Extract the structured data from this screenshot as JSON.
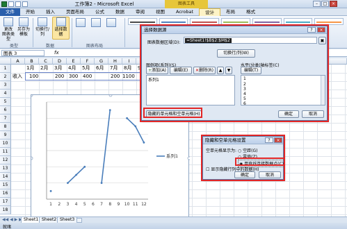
{
  "window": {
    "title": "工作簿2 - Microsoft Excel",
    "chart_tools": "图表工具"
  },
  "tabs": [
    "文件",
    "开始",
    "插入",
    "页面布局",
    "公式",
    "数据",
    "审阅",
    "视图",
    "Acrobat",
    "设计",
    "布局",
    "格式"
  ],
  "ribbon": {
    "change_type": "更改\n图表类型",
    "save_template": "另存为\n模板",
    "switch_rowcol": "切换行/列",
    "select_data": "选择数据",
    "group_type": "类型",
    "group_data": "数据",
    "group_layout": "图表布局"
  },
  "formula_bar": {
    "name_box": "图表 3",
    "fx": "fx"
  },
  "columns": [
    "A",
    "B",
    "C",
    "D",
    "E",
    "F",
    "G",
    "H",
    "I",
    "J"
  ],
  "rows": [
    "1",
    "2",
    "3",
    "4",
    "5",
    "6",
    "7",
    "8",
    "9",
    "10",
    "11",
    "12",
    "13",
    "14",
    "15",
    "16",
    "17",
    "18"
  ],
  "sheet": {
    "header_row": [
      "1月",
      "2月",
      "3月",
      "4月",
      "5月",
      "6月",
      "7月",
      "8月",
      "9月"
    ],
    "row2_label": "收入",
    "row2_values": [
      "100",
      "",
      "200",
      "300",
      "400",
      "",
      "200",
      "1100",
      ""
    ]
  },
  "chart_data": {
    "type": "line",
    "x": [
      1,
      2,
      3,
      4,
      5,
      6,
      7,
      8,
      9,
      10,
      11,
      12
    ],
    "series": [
      {
        "name": "系列1",
        "values": [
          100,
          null,
          200,
          300,
          400,
          null,
          200,
          1100,
          null,
          1000,
          900,
          700
        ]
      }
    ],
    "ylim": [
      0,
      1200
    ],
    "yticks": [
      0,
      200,
      400,
      600,
      800,
      1000,
      1200
    ],
    "legend": "right",
    "grid": true
  },
  "select_data_dialog": {
    "title": "选择数据源",
    "range_label": "图表数据区域(D):",
    "range_value": "=Sheet1!$B$2:$M$2",
    "switch_button": "切换行/列(W)",
    "legend_label": "图例项(系列)(S)",
    "add_button": "添加(A)",
    "edit_button": "编辑(E)",
    "delete_button": "删除(R)",
    "series_item": "系列1",
    "axis_label": "水平(分类)轴标签(C)",
    "axis_edit_button": "编辑(T)",
    "axis_items": [
      "1",
      "2",
      "3",
      "4",
      "5",
      "6"
    ],
    "hidden_button": "隐藏的单元格和空单元格(H)",
    "ok": "确定",
    "cancel": "取消"
  },
  "hidden_dialog": {
    "title": "隐藏和空单元格设置",
    "show_empty_as": "空单元格显示为:",
    "opt_gaps": "空距(G)",
    "opt_zero": "零值(Z)",
    "opt_connect": "用直线连接数据点(C)",
    "show_hidden": "显示隐藏行列中的数据(H)",
    "ok": "确定",
    "cancel": "取消"
  },
  "sheets": [
    "Sheet1",
    "Sheet2",
    "Sheet3"
  ],
  "status": {
    "ready": "就绪"
  }
}
